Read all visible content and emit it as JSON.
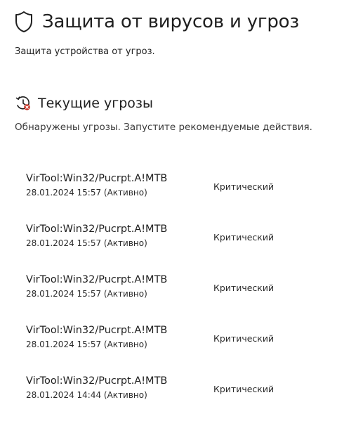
{
  "header": {
    "title": "Защита от вирусов и угроз",
    "subtitle": "Защита устройства от угроз."
  },
  "current_threats": {
    "title": "Текущие угрозы",
    "description": "Обнаружены угрозы. Запустите рекомендуемые действия.",
    "items": [
      {
        "name": "VirTool:Win32/Pucrpt.A!MTB",
        "date": "28.01.2024 15:57 (Активно)",
        "severity": "Критический"
      },
      {
        "name": "VirTool:Win32/Pucrpt.A!MTB",
        "date": "28.01.2024 15:57 (Активно)",
        "severity": "Критический"
      },
      {
        "name": "VirTool:Win32/Pucrpt.A!MTB",
        "date": "28.01.2024 15:57 (Активно)",
        "severity": "Критический"
      },
      {
        "name": "VirTool:Win32/Pucrpt.A!MTB",
        "date": "28.01.2024 15:57 (Активно)",
        "severity": "Критический"
      },
      {
        "name": "VirTool:Win32/Pucrpt.A!MTB",
        "date": "28.01.2024 14:44 (Активно)",
        "severity": "Критический"
      }
    ]
  },
  "icons": {
    "header": "shield-icon",
    "section": "threat-clock-icon"
  },
  "colors": {
    "text": "#1f1f1f",
    "alert": "#c42b1c"
  }
}
